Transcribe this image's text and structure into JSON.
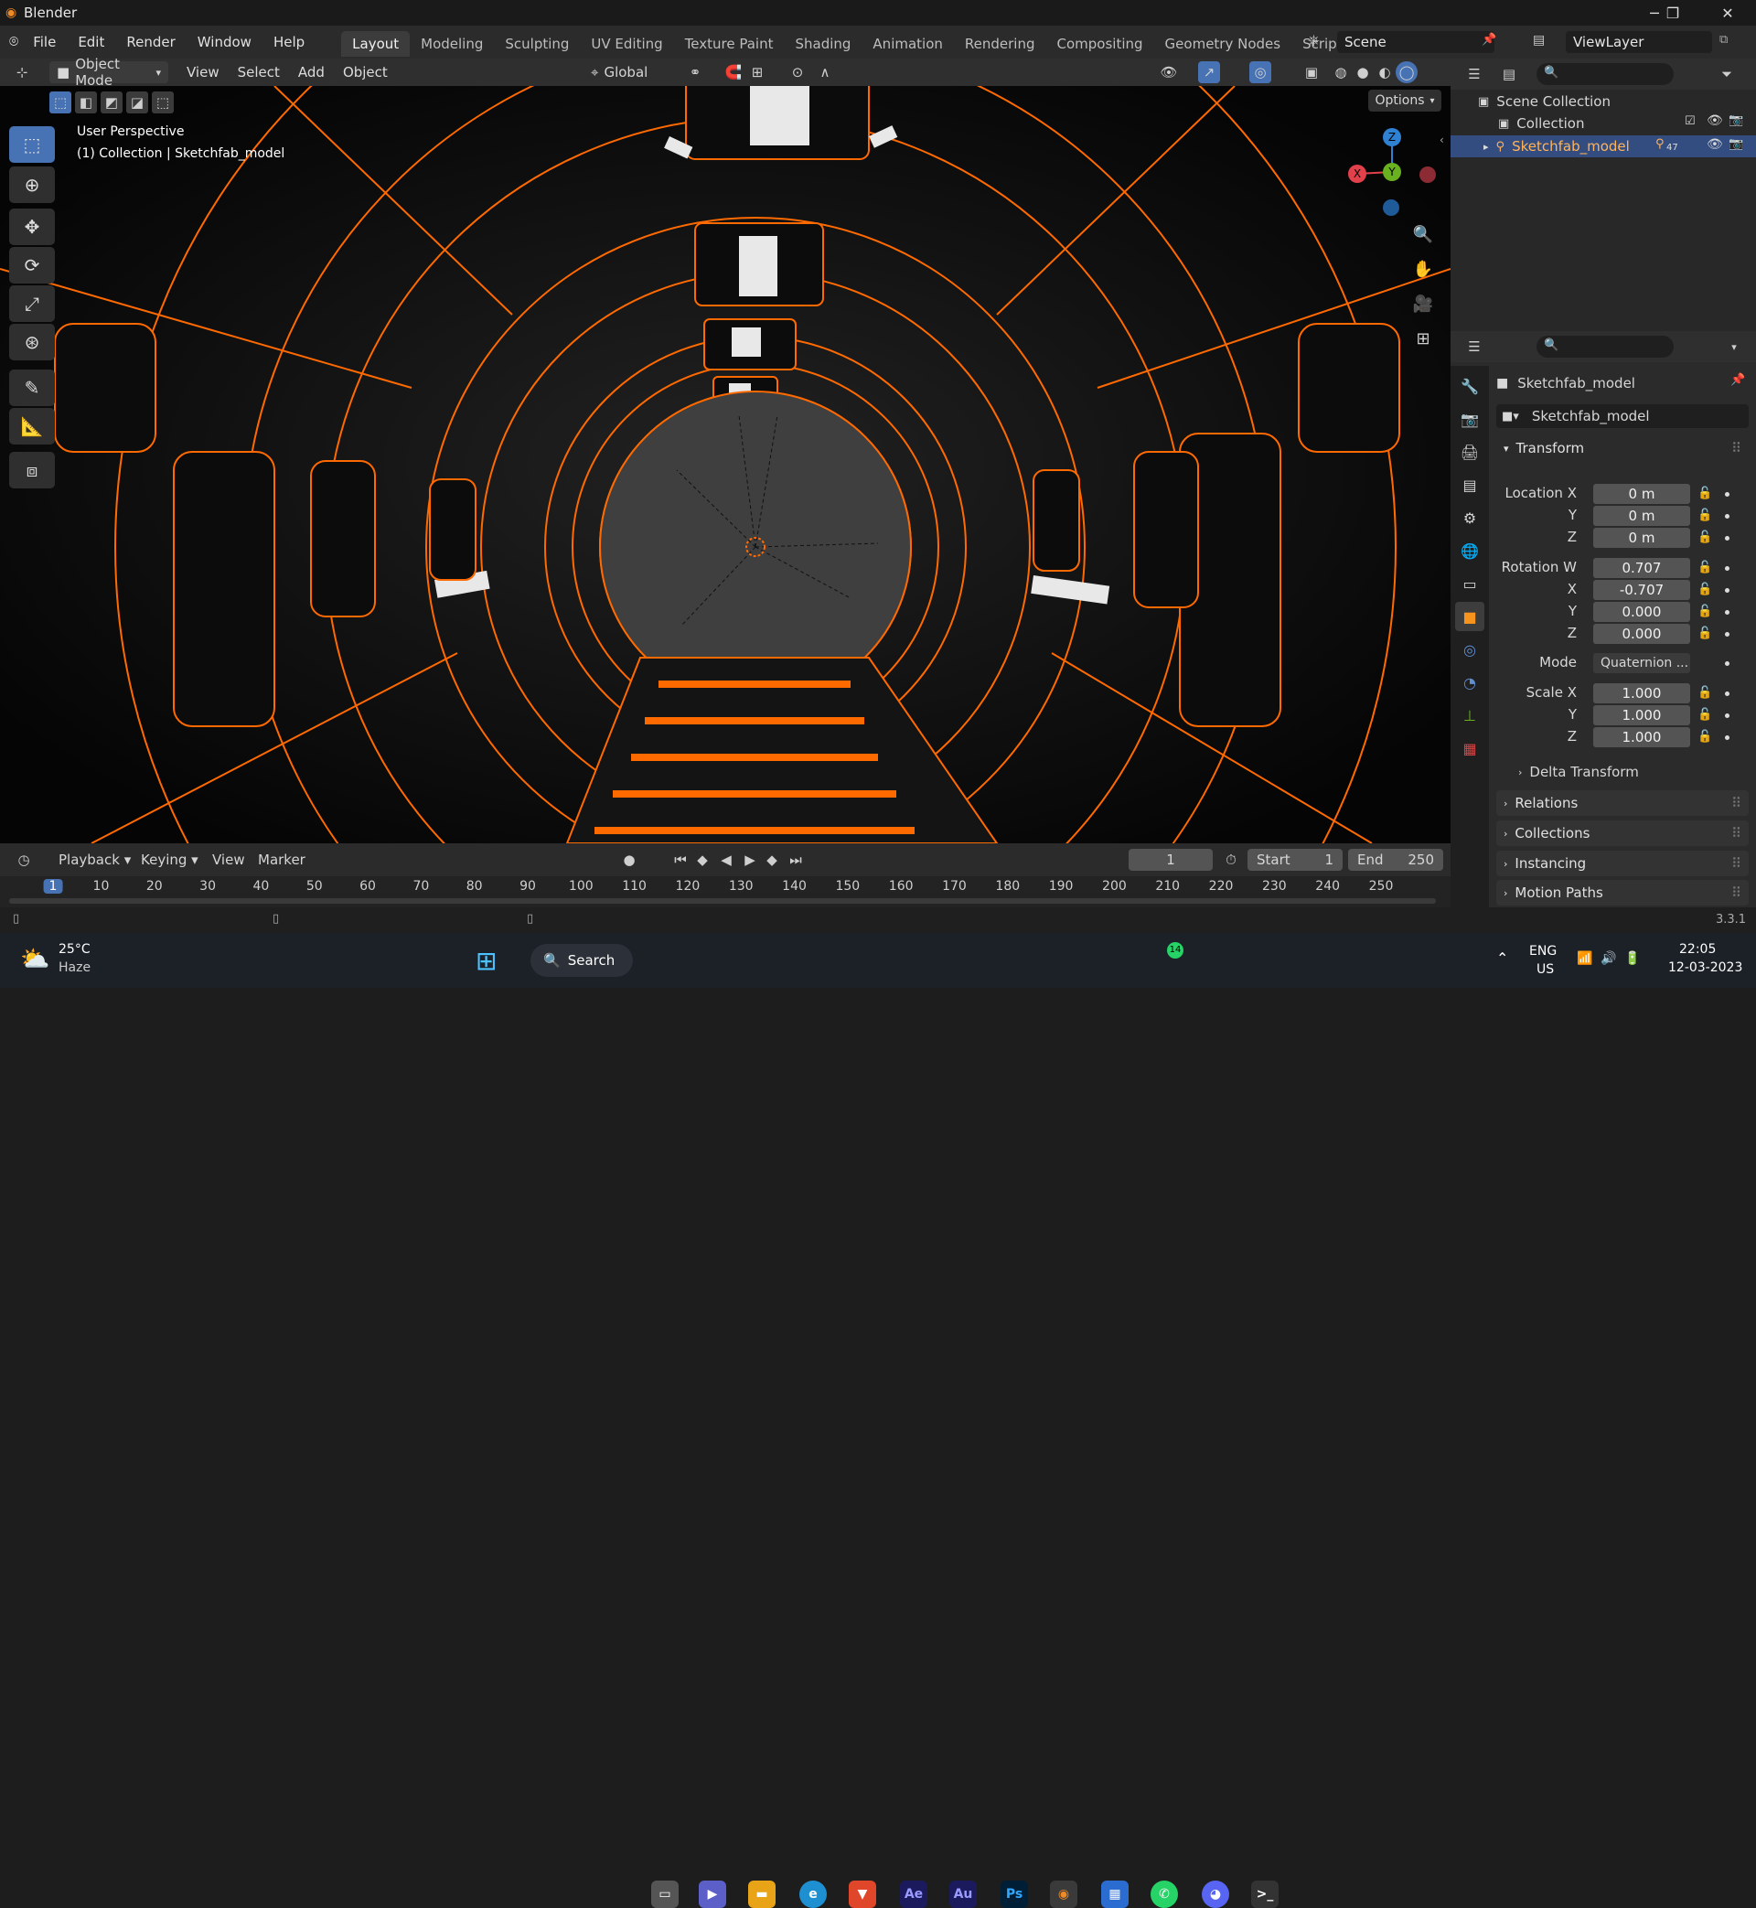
{
  "window": {
    "title": "Blender",
    "minimize": "─",
    "maximize": "❐",
    "close": "✕"
  },
  "menu": [
    "File",
    "Edit",
    "Render",
    "Window",
    "Help"
  ],
  "workspaces": [
    "Layout",
    "Modeling",
    "Sculpting",
    "UV Editing",
    "Texture Paint",
    "Shading",
    "Animation",
    "Rendering",
    "Compositing",
    "Geometry Nodes",
    "Scripting"
  ],
  "active_workspace": "Layout",
  "add_workspace": "+",
  "scene": {
    "name": "Scene",
    "view_layer": "ViewLayer"
  },
  "viewport_header": {
    "mode": "Object Mode",
    "menus": [
      "View",
      "Select",
      "Add",
      "Object"
    ],
    "transform_orientation": "Global",
    "options": "Options"
  },
  "viewport_overlay": {
    "perspective": "User Perspective",
    "collection_info": "(1) Collection | Sketchfab_model",
    "gizmo": {
      "z": "Z",
      "y": "Y",
      "x": "X"
    }
  },
  "outliner": {
    "items": [
      {
        "label": "Scene Collection"
      },
      {
        "label": "Collection"
      },
      {
        "label": "Sketchfab_model",
        "badge": "47"
      }
    ]
  },
  "properties": {
    "object_name": "Sketchfab_model",
    "data_name": "Sketchfab_model",
    "transform_label": "Transform",
    "location": {
      "label_x": "Location X",
      "label_y": "Y",
      "label_z": "Z",
      "x": "0 m",
      "y": "0 m",
      "z": "0 m"
    },
    "rotation": {
      "label_w": "Rotation W",
      "label_x": "X",
      "label_y": "Y",
      "label_z": "Z",
      "w": "0.707",
      "x": "-0.707",
      "y": "0.000",
      "z": "0.000"
    },
    "mode": {
      "label": "Mode",
      "value": "Quaternion ..."
    },
    "scale": {
      "label_x": "Scale X",
      "label_y": "Y",
      "label_z": "Z",
      "x": "1.000",
      "y": "1.000",
      "z": "1.000"
    },
    "delta_transform": "Delta Transform",
    "panels": [
      "Relations",
      "Collections",
      "Instancing",
      "Motion Paths"
    ]
  },
  "timeline": {
    "menus": [
      "Playback",
      "Keying",
      "View",
      "Marker"
    ],
    "current_frame": "1",
    "start_label": "Start",
    "start": "1",
    "end_label": "End",
    "end": "250",
    "ticks": [
      "1",
      "10",
      "20",
      "30",
      "40",
      "50",
      "60",
      "70",
      "80",
      "90",
      "100",
      "110",
      "120",
      "130",
      "140",
      "150",
      "160",
      "170",
      "180",
      "190",
      "200",
      "210",
      "220",
      "230",
      "240",
      "250"
    ]
  },
  "status": {
    "version": "3.3.1"
  },
  "taskbar": {
    "weather_temp": "25°C",
    "weather_desc": "Haze",
    "search": "Search",
    "apps": [
      "Ae",
      "Au",
      "Ps"
    ],
    "whatsapp_badge": "14",
    "lang": "ENG",
    "region": "US",
    "time": "22:05",
    "date": "12-03-2023"
  },
  "colors": {
    "accent": "#4772b3",
    "selection": "#ff6a00",
    "bg": "#1d1d1d"
  }
}
